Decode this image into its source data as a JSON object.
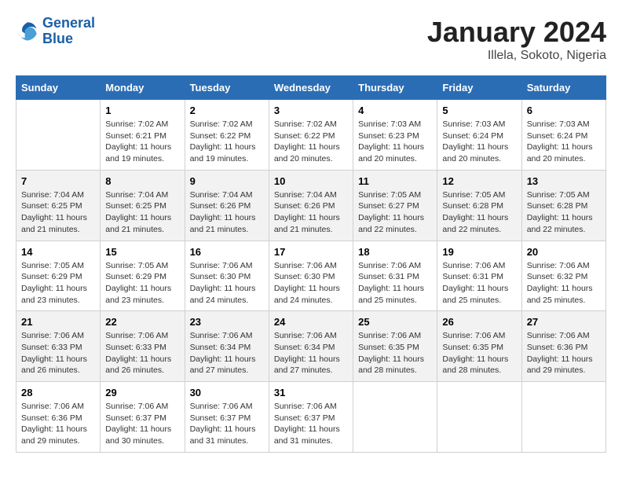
{
  "logo": {
    "text_general": "General",
    "text_blue": "Blue"
  },
  "title": "January 2024",
  "subtitle": "Illela, Sokoto, Nigeria",
  "days_of_week": [
    "Sunday",
    "Monday",
    "Tuesday",
    "Wednesday",
    "Thursday",
    "Friday",
    "Saturday"
  ],
  "weeks": [
    [
      {
        "day": "",
        "info": ""
      },
      {
        "day": "1",
        "info": "Sunrise: 7:02 AM\nSunset: 6:21 PM\nDaylight: 11 hours\nand 19 minutes."
      },
      {
        "day": "2",
        "info": "Sunrise: 7:02 AM\nSunset: 6:22 PM\nDaylight: 11 hours\nand 19 minutes."
      },
      {
        "day": "3",
        "info": "Sunrise: 7:02 AM\nSunset: 6:22 PM\nDaylight: 11 hours\nand 20 minutes."
      },
      {
        "day": "4",
        "info": "Sunrise: 7:03 AM\nSunset: 6:23 PM\nDaylight: 11 hours\nand 20 minutes."
      },
      {
        "day": "5",
        "info": "Sunrise: 7:03 AM\nSunset: 6:24 PM\nDaylight: 11 hours\nand 20 minutes."
      },
      {
        "day": "6",
        "info": "Sunrise: 7:03 AM\nSunset: 6:24 PM\nDaylight: 11 hours\nand 20 minutes."
      }
    ],
    [
      {
        "day": "7",
        "info": "Sunrise: 7:04 AM\nSunset: 6:25 PM\nDaylight: 11 hours\nand 21 minutes."
      },
      {
        "day": "8",
        "info": "Sunrise: 7:04 AM\nSunset: 6:25 PM\nDaylight: 11 hours\nand 21 minutes."
      },
      {
        "day": "9",
        "info": "Sunrise: 7:04 AM\nSunset: 6:26 PM\nDaylight: 11 hours\nand 21 minutes."
      },
      {
        "day": "10",
        "info": "Sunrise: 7:04 AM\nSunset: 6:26 PM\nDaylight: 11 hours\nand 21 minutes."
      },
      {
        "day": "11",
        "info": "Sunrise: 7:05 AM\nSunset: 6:27 PM\nDaylight: 11 hours\nand 22 minutes."
      },
      {
        "day": "12",
        "info": "Sunrise: 7:05 AM\nSunset: 6:28 PM\nDaylight: 11 hours\nand 22 minutes."
      },
      {
        "day": "13",
        "info": "Sunrise: 7:05 AM\nSunset: 6:28 PM\nDaylight: 11 hours\nand 22 minutes."
      }
    ],
    [
      {
        "day": "14",
        "info": "Sunrise: 7:05 AM\nSunset: 6:29 PM\nDaylight: 11 hours\nand 23 minutes."
      },
      {
        "day": "15",
        "info": "Sunrise: 7:05 AM\nSunset: 6:29 PM\nDaylight: 11 hours\nand 23 minutes."
      },
      {
        "day": "16",
        "info": "Sunrise: 7:06 AM\nSunset: 6:30 PM\nDaylight: 11 hours\nand 24 minutes."
      },
      {
        "day": "17",
        "info": "Sunrise: 7:06 AM\nSunset: 6:30 PM\nDaylight: 11 hours\nand 24 minutes."
      },
      {
        "day": "18",
        "info": "Sunrise: 7:06 AM\nSunset: 6:31 PM\nDaylight: 11 hours\nand 25 minutes."
      },
      {
        "day": "19",
        "info": "Sunrise: 7:06 AM\nSunset: 6:31 PM\nDaylight: 11 hours\nand 25 minutes."
      },
      {
        "day": "20",
        "info": "Sunrise: 7:06 AM\nSunset: 6:32 PM\nDaylight: 11 hours\nand 25 minutes."
      }
    ],
    [
      {
        "day": "21",
        "info": "Sunrise: 7:06 AM\nSunset: 6:33 PM\nDaylight: 11 hours\nand 26 minutes."
      },
      {
        "day": "22",
        "info": "Sunrise: 7:06 AM\nSunset: 6:33 PM\nDaylight: 11 hours\nand 26 minutes."
      },
      {
        "day": "23",
        "info": "Sunrise: 7:06 AM\nSunset: 6:34 PM\nDaylight: 11 hours\nand 27 minutes."
      },
      {
        "day": "24",
        "info": "Sunrise: 7:06 AM\nSunset: 6:34 PM\nDaylight: 11 hours\nand 27 minutes."
      },
      {
        "day": "25",
        "info": "Sunrise: 7:06 AM\nSunset: 6:35 PM\nDaylight: 11 hours\nand 28 minutes."
      },
      {
        "day": "26",
        "info": "Sunrise: 7:06 AM\nSunset: 6:35 PM\nDaylight: 11 hours\nand 28 minutes."
      },
      {
        "day": "27",
        "info": "Sunrise: 7:06 AM\nSunset: 6:36 PM\nDaylight: 11 hours\nand 29 minutes."
      }
    ],
    [
      {
        "day": "28",
        "info": "Sunrise: 7:06 AM\nSunset: 6:36 PM\nDaylight: 11 hours\nand 29 minutes."
      },
      {
        "day": "29",
        "info": "Sunrise: 7:06 AM\nSunset: 6:37 PM\nDaylight: 11 hours\nand 30 minutes."
      },
      {
        "day": "30",
        "info": "Sunrise: 7:06 AM\nSunset: 6:37 PM\nDaylight: 11 hours\nand 31 minutes."
      },
      {
        "day": "31",
        "info": "Sunrise: 7:06 AM\nSunset: 6:37 PM\nDaylight: 11 hours\nand 31 minutes."
      },
      {
        "day": "",
        "info": ""
      },
      {
        "day": "",
        "info": ""
      },
      {
        "day": "",
        "info": ""
      }
    ]
  ]
}
